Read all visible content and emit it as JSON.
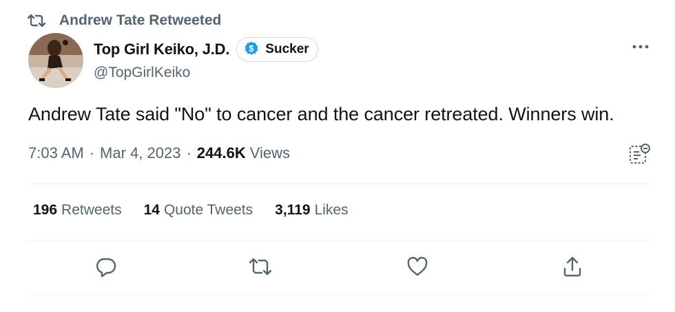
{
  "retweet_header": {
    "label": "Andrew Tate Retweeted"
  },
  "author": {
    "display_name": "Top Girl Keiko, J.D.",
    "handle": "@TopGirlKeiko",
    "badge": {
      "icon": "dollar-coin-icon",
      "label": "Sucker",
      "color": "#1d9bf0"
    }
  },
  "tweet": {
    "text": "Andrew Tate said \"No\" to cancer and the cancer retreated. Winners win."
  },
  "meta": {
    "time": "7:03 AM",
    "separator": "·",
    "date": "Mar 4, 2023",
    "views_count": "244.6K",
    "views_label": "Views"
  },
  "stats": [
    {
      "count": "196",
      "label": "Retweets"
    },
    {
      "count": "14",
      "label": "Quote Tweets"
    },
    {
      "count": "3,119",
      "label": "Likes"
    }
  ],
  "actions": [
    {
      "name": "reply",
      "icon": "reply-icon"
    },
    {
      "name": "retweet",
      "icon": "retweet-icon"
    },
    {
      "name": "like",
      "icon": "heart-icon"
    },
    {
      "name": "share",
      "icon": "share-icon"
    }
  ],
  "colors": {
    "text_primary": "#0f1419",
    "text_secondary": "#536471",
    "divider": "#eff3f4",
    "verified_blue": "#1d9bf0"
  }
}
